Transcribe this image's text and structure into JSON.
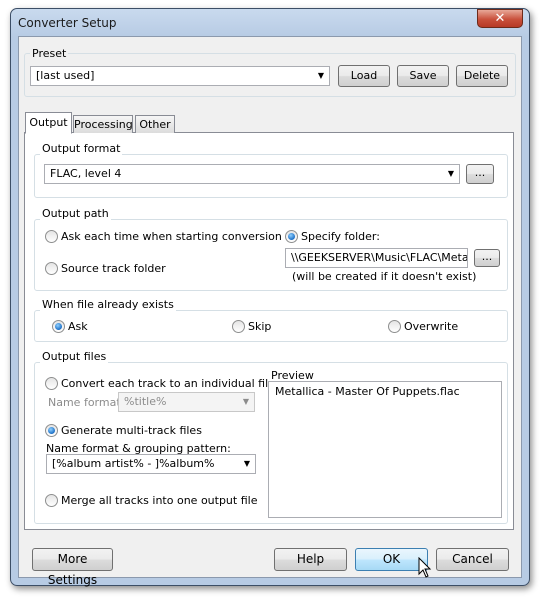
{
  "window": {
    "title": "Converter Setup",
    "close_glyph": "✕"
  },
  "preset": {
    "group_label": "Preset",
    "value": "[last used]",
    "load_label": "Load",
    "save_label": "Save",
    "delete_label": "Delete"
  },
  "tabs": [
    {
      "label": "Output",
      "active": true
    },
    {
      "label": "Processing",
      "active": false
    },
    {
      "label": "Other",
      "active": false
    }
  ],
  "output_format": {
    "group_label": "Output format",
    "value": "FLAC, level 4",
    "browse_label": "..."
  },
  "output_path": {
    "group_label": "Output path",
    "ask_each_time": "Ask each time when starting conversion",
    "source_track_folder": "Source track folder",
    "specify_folder": "Specify folder:",
    "folder_value": "\\\\GEEKSERVER\\Music\\FLAC\\Metallica",
    "browse_label": "...",
    "note": "(will be created if it doesn't exist)",
    "selected": "specify_folder"
  },
  "file_exists": {
    "group_label": "When file already exists",
    "ask": "Ask",
    "skip": "Skip",
    "overwrite": "Overwrite",
    "selected": "ask"
  },
  "output_files": {
    "group_label": "Output files",
    "convert_each": "Convert each track to an individual file",
    "name_format_label": "Name format:",
    "name_format_value": "%title%",
    "generate_multi": "Generate multi-track files",
    "grouping_label": "Name format & grouping pattern:",
    "grouping_value": "[%album artist% - ]%album%",
    "merge_all": "Merge all tracks into one output file",
    "preview_label": "Preview",
    "preview_value": "Metallica - Master Of Puppets.flac",
    "selected": "generate_multi"
  },
  "footer": {
    "more_settings_label": "More Settings",
    "help_label": "Help",
    "ok_label": "OK",
    "cancel_label": "Cancel"
  },
  "icons": {
    "dropdown": "▼",
    "cursor": "pointer-cursor-icon"
  }
}
